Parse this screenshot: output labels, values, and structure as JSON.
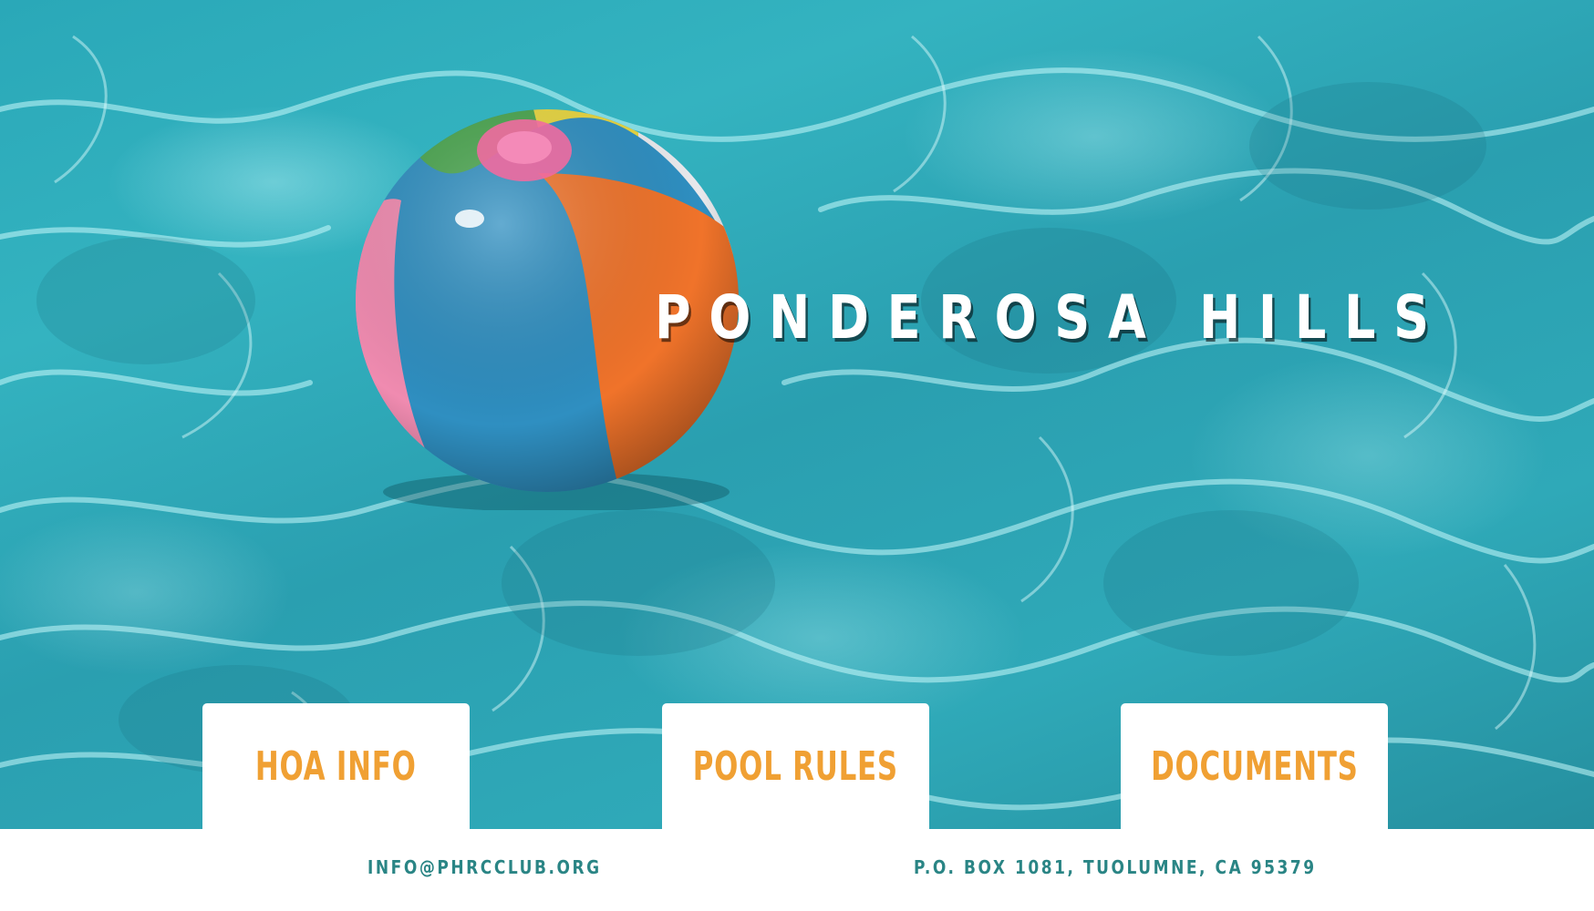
{
  "hero": {
    "title": "PONDEROSA HILLS"
  },
  "nav_cards": [
    {
      "label": "HOA INFO"
    },
    {
      "label": "POOL RULES"
    },
    {
      "label": "DOCUMENTS"
    }
  ],
  "footer": {
    "email": "INFO@PHRCCLUB.ORG",
    "address": "P.O. BOX 1081, TUOLUMNE, CA 95379"
  },
  "colors": {
    "card_text": "#f0a033",
    "footer_text": "#2a8585",
    "water": "#2aa8b8",
    "title": "#ffffff"
  },
  "icons": {
    "hero_image": "beach-ball-in-pool"
  }
}
